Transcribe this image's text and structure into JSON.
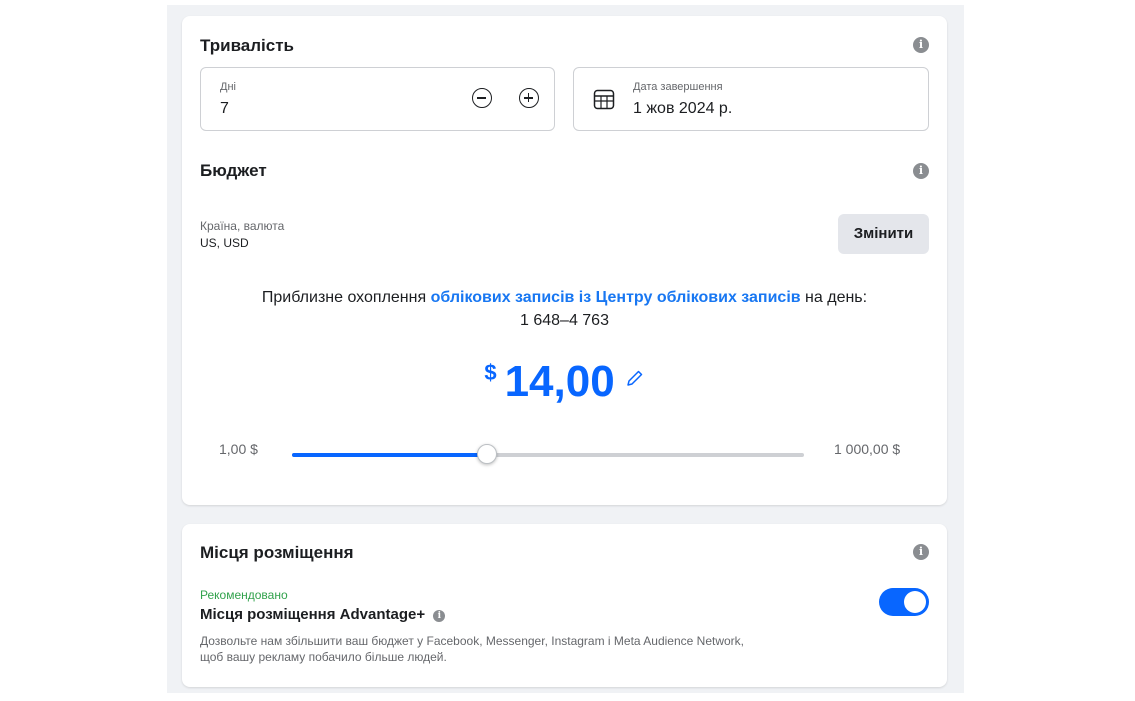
{
  "duration": {
    "title": "Тривалість",
    "days_label": "Дні",
    "days_value": "7",
    "end_date_label": "Дата завершення",
    "end_date_value": "1 жов 2024 р."
  },
  "budget": {
    "title": "Бюджет",
    "country_label": "Країна, валюта",
    "country_value": "US, USD",
    "change_button": "Змінити",
    "reach_prefix": "Приблизне охоплення ",
    "reach_link": "облікових записів із Центру облікових записів",
    "reach_suffix": " на день:",
    "reach_range": "1 648–4 763",
    "currency_symbol": "$",
    "amount": "14,00",
    "slider": {
      "min_label": "1,00 $",
      "max_label": "1 000,00 $",
      "position": 0.38
    }
  },
  "placements": {
    "title": "Місця розміщення",
    "recommended": "Рекомендовано",
    "advantage_title": "Місця розміщення Advantage+",
    "advantage_desc_line1": "Дозвольте нам збільшити ваш бюджет у Facebook, Messenger, Instagram і Meta Audience Network,",
    "advantage_desc_line2": "щоб вашу рекламу побачило більше людей.",
    "toggle_on": true
  },
  "colors": {
    "accent": "#0866ff",
    "link": "#1877f2",
    "recommended": "#31a24c"
  },
  "icons": {
    "info": "info-icon",
    "minus": "minus-circle-icon",
    "plus": "plus-circle-icon",
    "calendar": "calendar-icon",
    "edit": "pencil-icon"
  }
}
